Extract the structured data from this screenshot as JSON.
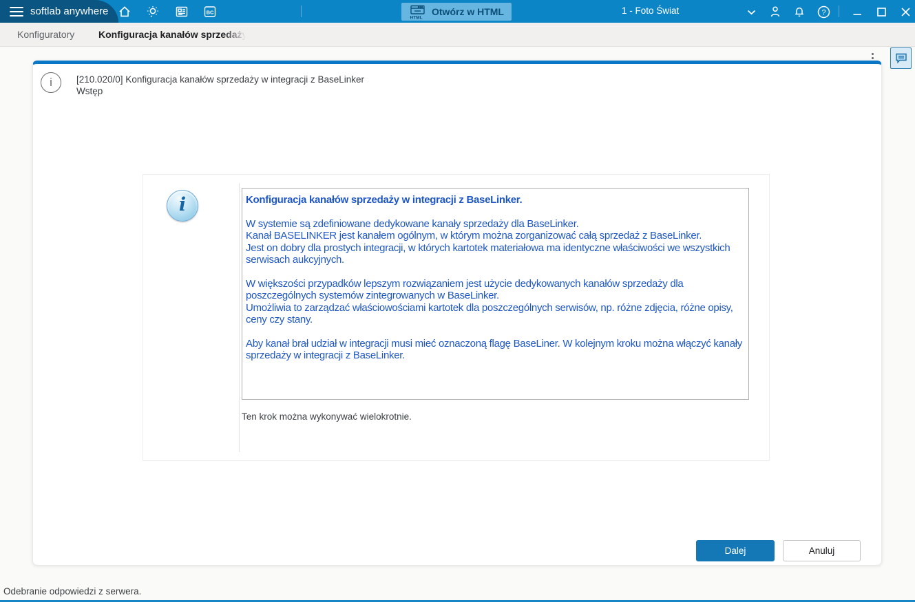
{
  "titlebar": {
    "app_name": "softlab anywhere",
    "open_html_label": "Otwórz w HTML",
    "html_icon_text": "HTML",
    "company_selector": "1 - Foto Świat"
  },
  "tabs": {
    "inactive": "Konfiguratory",
    "active": "Konfiguracja kanałów sprzedaży"
  },
  "wizard": {
    "header_icon": "i",
    "code_title": "[210.020/0] Konfiguracja kanałów sprzedaży w integracji z BaseLinker",
    "step_title": "Wstęp",
    "info_icon_letter": "i",
    "info_box": {
      "heading": "Konfiguracja kanałów sprzedaży w integracji z BaseLinker.",
      "paragraphs": [
        "W systemie są zdefiniowane dedykowane kanały sprzedaży dla BaseLinker.\nKanał BASELINKER jest kanałem ogólnym, w którym można zorganizować całą sprzedaż z BaseLinker.\nJest on dobry dla prostych integracji, w których kartotek materiałowa ma identyczne właściwości we wszystkich serwisach aukcyjnych.",
        "W większości przypadków lepszym rozwiązaniem jest użycie dedykowanych kanałów sprzedaży dla poszczególnych systemów zintegrowanych w BaseLinker.\nUmożliwia to zarządzać właściowościami kartotek dla poszczególnych serwisów, np. różne zdjęcia, różne opisy, ceny czy stany.",
        "Aby kanał brał udział w integracji musi mieć oznaczoną flagę BaseLiner. W kolejnym kroku można włączyć kanały sprzedaży w integracji z BaseLinker."
      ]
    },
    "note": "Ten krok można wykonywać wielokrotnie.",
    "buttons": {
      "next": "Dalej",
      "cancel": "Anuluj"
    }
  },
  "statusbar": {
    "message": "Odebranie odpowiedzi z serwera."
  },
  "colors": {
    "titlebar": "#0C85C6",
    "titlebar_dark": "#0A5581",
    "accent": "#1A86C8",
    "primary_button": "#1478B6",
    "info_text_blue": "#1E57C5"
  }
}
